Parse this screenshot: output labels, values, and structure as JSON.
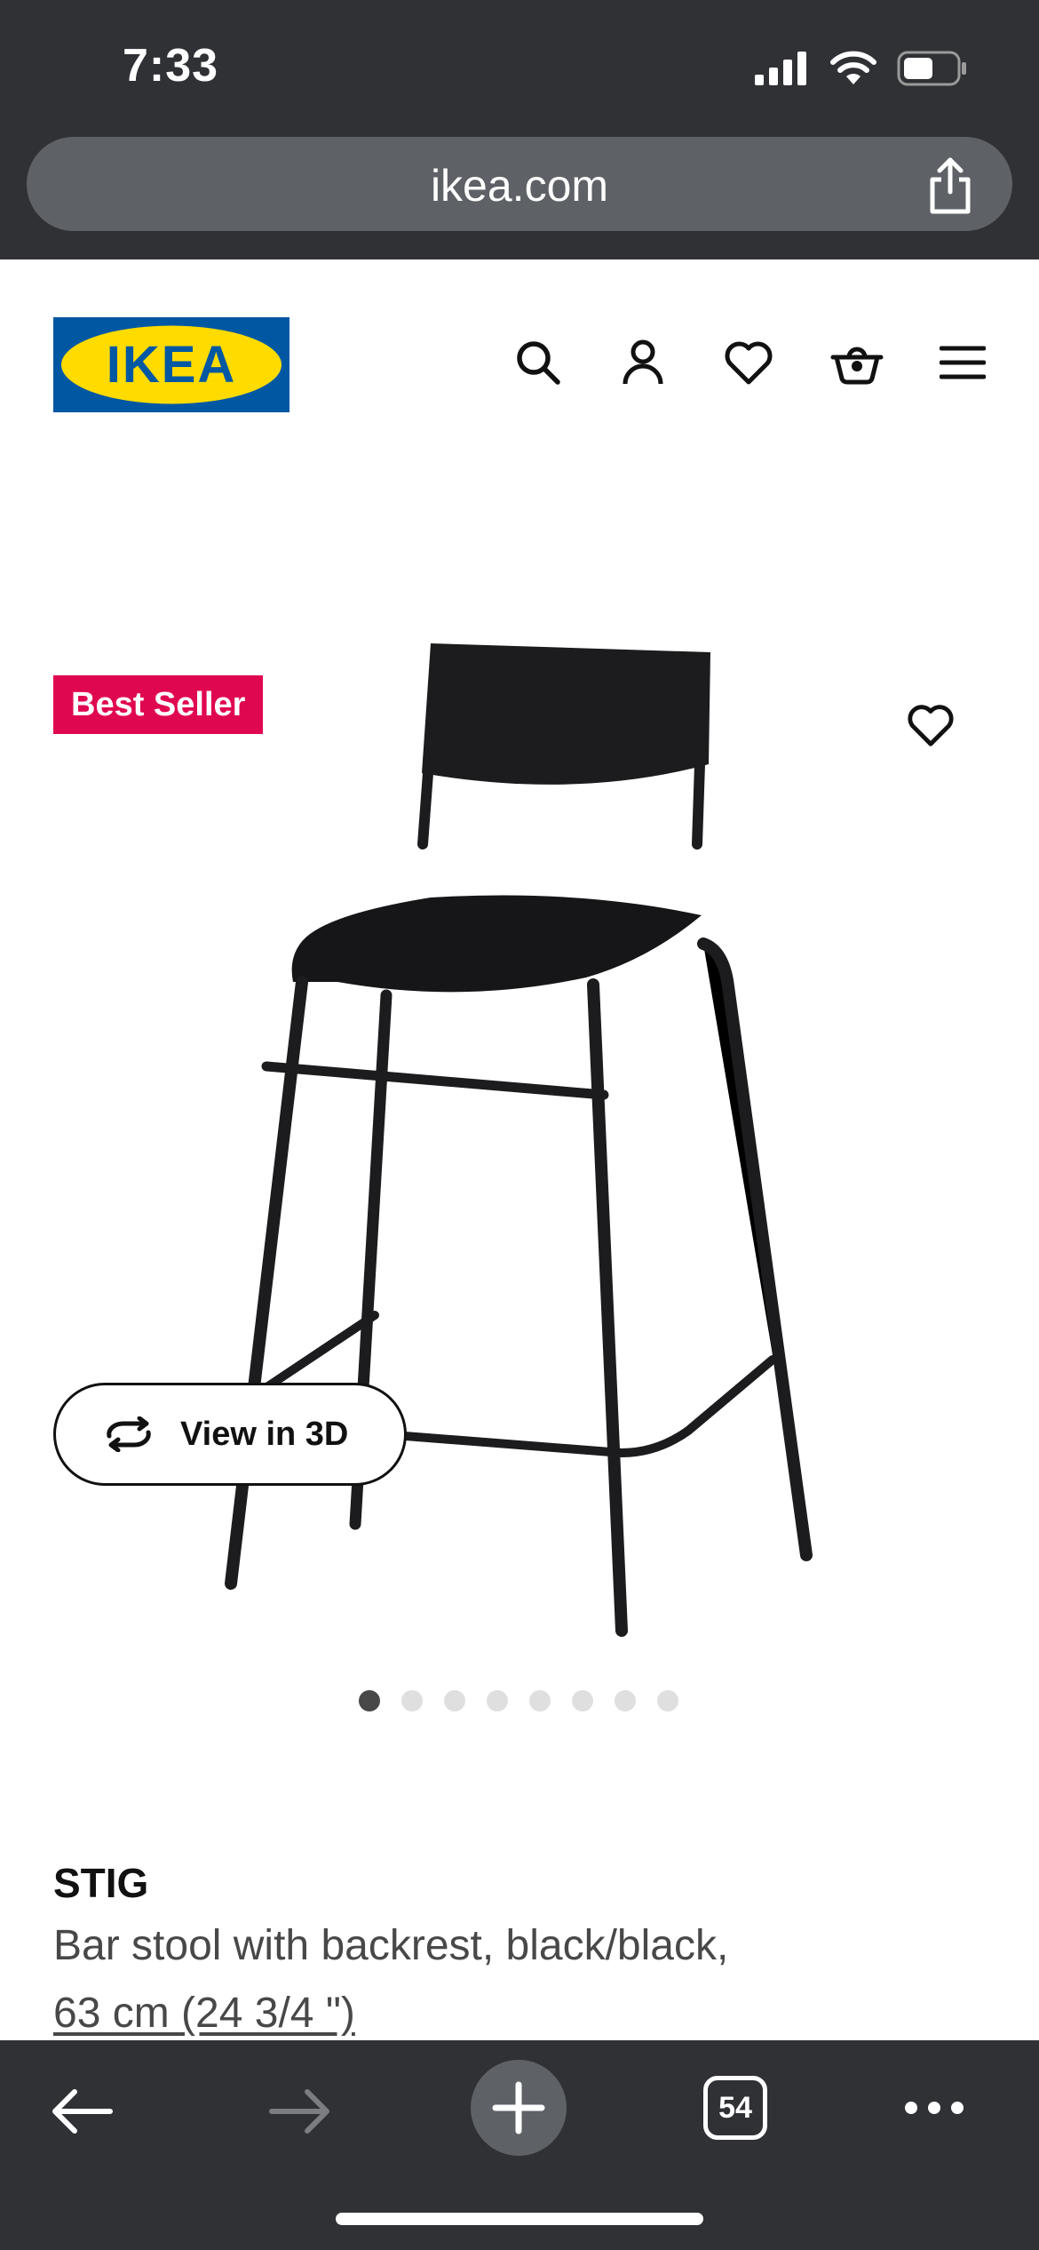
{
  "status_bar": {
    "time": "7:33"
  },
  "browser": {
    "url": "ikea.com",
    "tab_count": "54"
  },
  "header": {
    "logo_text": "IKEA",
    "icons": [
      "search-icon",
      "account-icon",
      "heart-icon",
      "basket-icon",
      "menu-icon"
    ]
  },
  "product": {
    "badge": "Best Seller",
    "view_3d_label": "View in 3D",
    "image_count": 8,
    "active_image": 1,
    "name": "STIG",
    "description": "Bar stool with backrest, black/black,",
    "size": "63 cm (24 3/4 \")"
  },
  "colors": {
    "browser_chrome": "#2f3135",
    "url_bar": "#5e6165",
    "ikea_blue": "#0058a3",
    "ikea_yellow": "#ffdb00",
    "badge_red": "#e00751"
  }
}
